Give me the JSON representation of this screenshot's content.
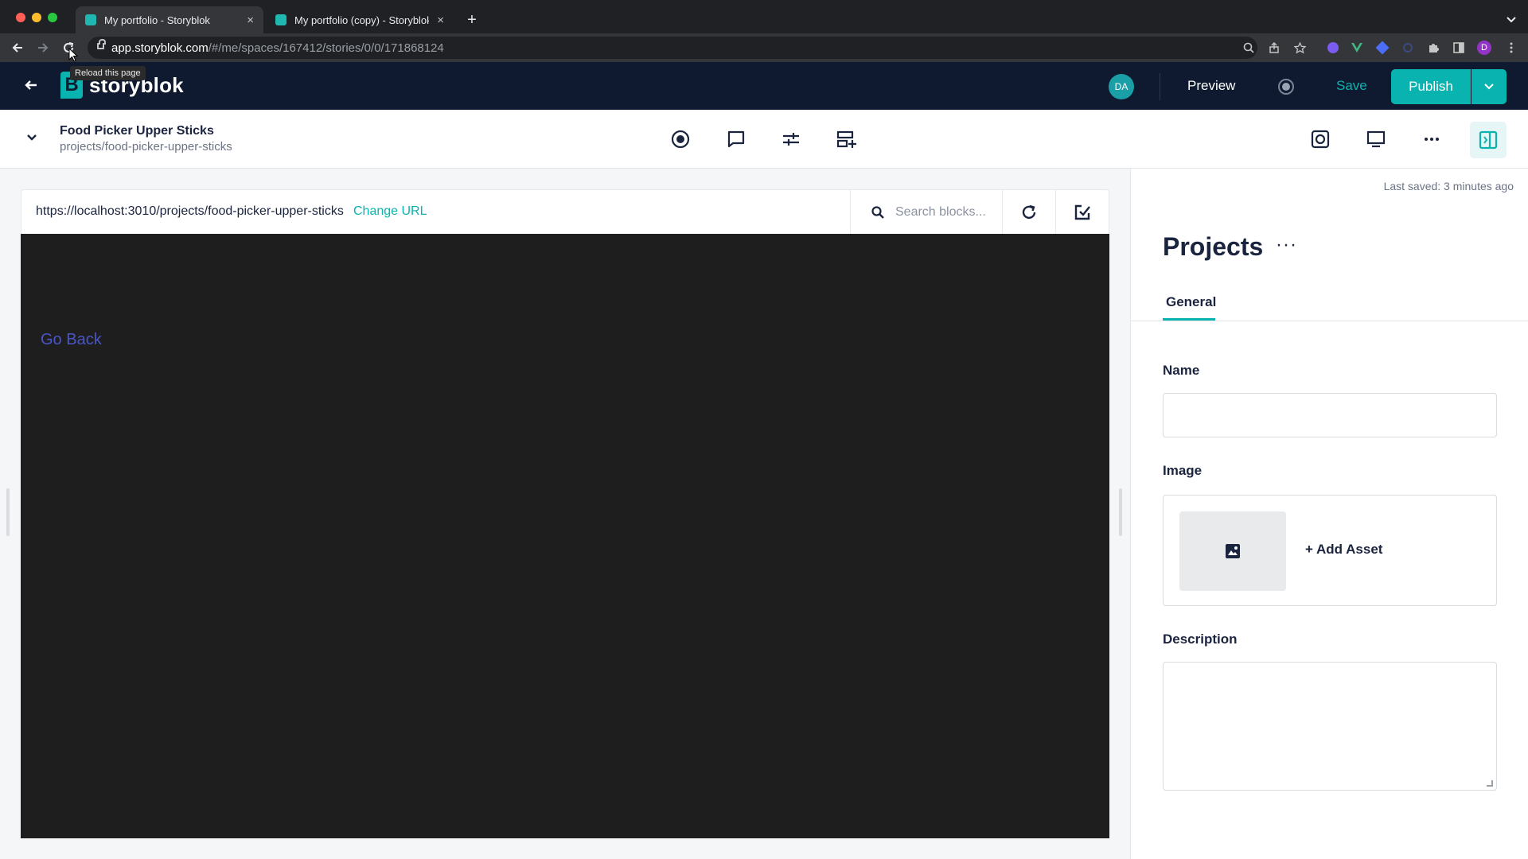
{
  "browser": {
    "tabs": [
      {
        "title": "My portfolio - Storyblok",
        "close": "×"
      },
      {
        "title": "My portfolio (copy) - Storyblok",
        "close": "×"
      }
    ],
    "new_tab": "+",
    "url_host": "app.storyblok.com",
    "url_path": "/#/me/spaces/167412/stories/0/0/171868124",
    "tooltip": "Reload this page",
    "profile_initial": "D"
  },
  "header": {
    "logo_text": "storyblok",
    "logo_mark": "B",
    "avatar_initials": "DA",
    "preview_label": "Preview",
    "save_label": "Save",
    "publish_label": "Publish"
  },
  "story": {
    "title": "Food Picker Upper Sticks",
    "slug": "projects/food-picker-upper-sticks"
  },
  "preview": {
    "url": "https://localhost:3010/projects/food-picker-upper-sticks",
    "change_url_label": "Change URL",
    "search_placeholder": "Search blocks...",
    "go_back_label": "Go Back"
  },
  "panel": {
    "last_saved": "Last saved: 3 minutes ago",
    "title": "Projects",
    "more": "···",
    "tab_general": "General",
    "fields": {
      "name_label": "Name",
      "name_value": "",
      "image_label": "Image",
      "add_asset_label": "+ Add Asset",
      "description_label": "Description",
      "description_value": ""
    }
  },
  "colors": {
    "accent": "#09b3af",
    "header_bg": "#0f1a30",
    "preview_bg": "#1e1e1e",
    "link": "#4a55c8"
  }
}
